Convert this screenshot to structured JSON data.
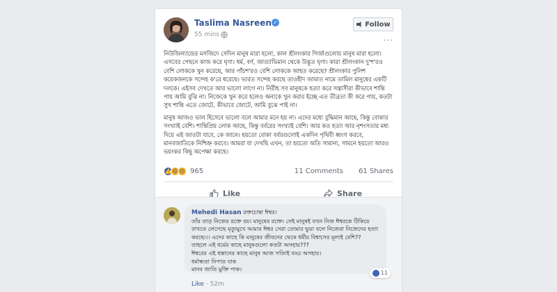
{
  "post": {
    "author": "Taslima Nasreen",
    "time": "55 mins",
    "follow_label": "Follow",
    "more": "···",
    "paragraphs": [
      "নিউজিল্যান্ডের মসজিদে সেদিন মানুষ মারা হলো, কাল শ্রীলংকার গির্জাগুলোয় মানুষ মারা হলো। এসবের পেছনে কাজ করে ঘৃণা। ধর্ম, বর্ণ, জাত্যাভিমান থেকে উদ্ভূত ঘৃণা। কারা শ্রীলংকান দু'শ'রও বেশি লোককে খুন করেছে, আর পাঁচশ'রও বেশি লোককে আহত করেছে? শ্রীলংকার পুলিশ কয়েকজনকে সন্দেহ ক'রে ধরেছে। ভারত সন্দেহ করছে তাওহীদ জামাত নামে তামিল মানুষের একটি দলকে। এইসব দেখতে আর ভালো লাগে না। নিরীহ সব মানুষকে হত্যা করে সন্ত্রাসীরা কীভাবে শান্তি পায় আমি বুঝি না। নিজেকে খুন করে হলেও অন্যকে খুন করার ইচ্ছে এত তীব্রতা কী করে পায়, কতটা সুখ শান্তি এতে জোটে, কীভাবে জোটে, আমি বুঝে পাই না।",
      "মানুষ আজও ভাল হিসেবে ভালো বলে আমার মনে হয় না। এদের মধ্যে বুদ্ধিমান আছে, কিন্তু বোকার সংখ্যাই বেশি। শান্তিপ্রিয় লোক আছে, কিন্তু বর্বরের সংখ্যাই বেশি। আর কত হত্যা আর নৃশংসতার মধ্য দিয়ে এই জাতটা যাবে, কে জানে। হয়তো বোকা বর্বরগুলোই একদিন পৃথিবী ধ্বংস করবে, মানবজাতিকে নিশ্চিহ্ন করবে। আমরা যা দেখছি এখন, তা হয়তো অতি সামান্য, সামনে হয়তো আরও ভয়ংকর কিছু অপেক্ষা করছে।"
    ],
    "reaction_count": "965",
    "comments_count": "11 Comments",
    "shares_count": "61 Shares",
    "like_label": "Like",
    "share_label": "Share"
  },
  "comment": {
    "author": "Mehedi Hasan",
    "first_line": "রক্তচোষা ঈশ্বর।",
    "lines": [
      "তাঁর তাড় নিজের রক্তে রয়। মানুষের রক্তে। সেই মানুষই যখন নিজ ঈশ্বরকে টিকিয়ে",
      "রাখতে লেগেছে মৃত্যুমুখে আমার ঈশ্বর সেরা তোমার ভুয়া বলে নিজেরা নিজেদের হত্যা",
      "করছে।।। এদের কাছে কি মানুষের জীবনের থেকে ধর্মীয় বিশ্বাসের মূল্যই বেশি??",
      "তাহলে এই ধর্মের কাছে মানুষগুলো কতটা অসহায়???",
      "ঈশ্বরের এই ধস্তানের কাছে মানুষ আজ সত্যিই বড্ড অসহায়।",
      "ধর্মান্ধতা নিপাত যাক",
      "মানব জাতি মুক্তি পাক।"
    ],
    "reaction_count": "11",
    "like_link": "Like",
    "time": "52m"
  },
  "colors": {
    "link": "#365899",
    "reaction_like": "#4267b2",
    "reaction_haha": "#f7b125",
    "reaction_sad": "#f7b125"
  }
}
